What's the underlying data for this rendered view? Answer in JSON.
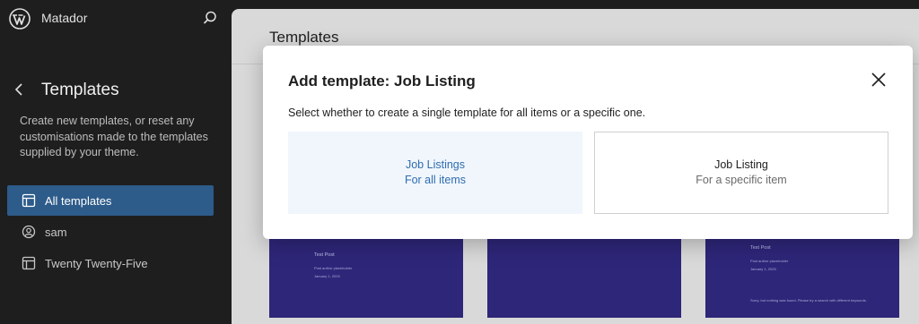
{
  "app": {
    "site_name": "Matador"
  },
  "sidebar": {
    "title": "Templates",
    "description": "Create new templates, or reset any customisations made to the templates supplied by your theme.",
    "items": [
      {
        "label": "All templates",
        "icon": "layout-icon",
        "active": true
      },
      {
        "label": "sam",
        "icon": "user-icon",
        "active": false
      },
      {
        "label": "Twenty Twenty-Five",
        "icon": "layout-icon",
        "active": false
      }
    ]
  },
  "main": {
    "title": "Templates",
    "cards": [
      {
        "heading": "Test Post",
        "line1": "Post author placeholder",
        "line2": "January 1, 2025"
      },
      {
        "heading": "",
        "line1": "",
        "line2": ""
      },
      {
        "heading": "Test Post",
        "line1": "Post author placeholder",
        "line2": "January 1, 2025",
        "footer": "Sorry, but nothing was found. Please try a search with different keywords."
      }
    ]
  },
  "modal": {
    "title": "Add template: Job Listing",
    "description": "Select whether to create a single template for all items or a specific one.",
    "options": [
      {
        "title": "Job Listings",
        "subtitle": "For all items",
        "selected": true
      },
      {
        "title": "Job Listing",
        "subtitle": "For a specific item",
        "selected": false
      }
    ]
  },
  "colors": {
    "accent": "#2f6db0",
    "sidebar_bg": "#1e1e1e",
    "active_nav": "#2d5b8a",
    "card_bg": "#2e2679"
  }
}
